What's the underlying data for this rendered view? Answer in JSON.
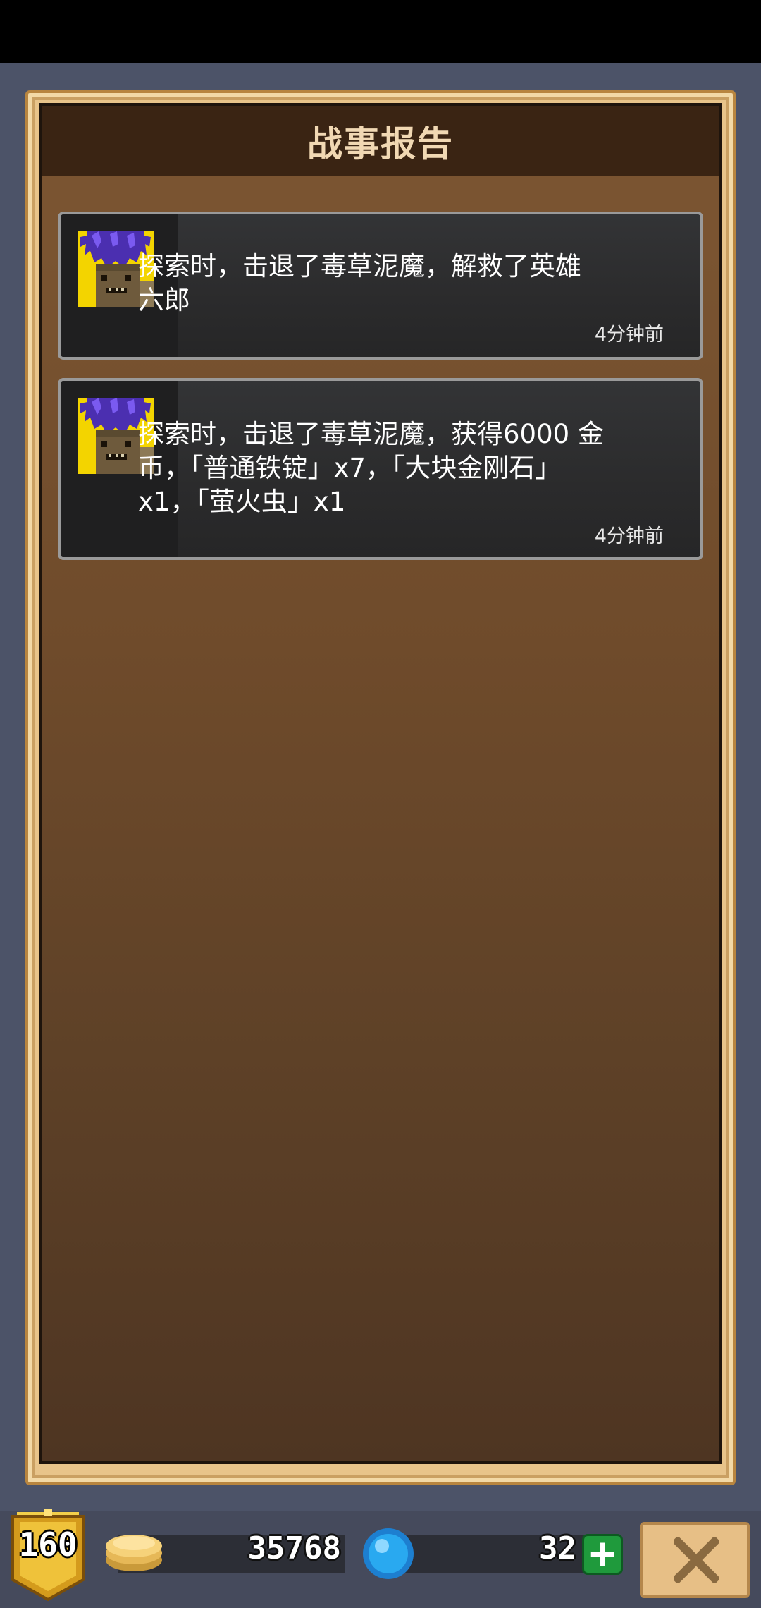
{
  "window": {
    "title": "战事报告"
  },
  "reports": [
    {
      "lines": [
        "探索时，击退了毒草泥魔，解救了英雄",
        "六郎"
      ],
      "time": "4分钟前",
      "portrait_icon": "poison-grass-mud-monster-icon"
    },
    {
      "lines": [
        "探索时，击退了毒草泥魔，获得6000 金",
        "币，「普通铁锭」x7，「大块金刚石」",
        "x1，「萤火虫」x1"
      ],
      "time": "4分钟前",
      "portrait_icon": "poison-grass-mud-monster-icon"
    }
  ],
  "footer": {
    "level": "160",
    "coins": "35768",
    "gems": "32",
    "plus_label": "+",
    "close_icon": "close-icon"
  },
  "colors": {
    "frame": "#e8c48a",
    "panel_brown": "#6f4b2b",
    "title_bar": "#3a2413",
    "card_bg": "#2a2a2b",
    "gem_blue": "#29a9f0",
    "plus_green": "#1f9a3c"
  }
}
